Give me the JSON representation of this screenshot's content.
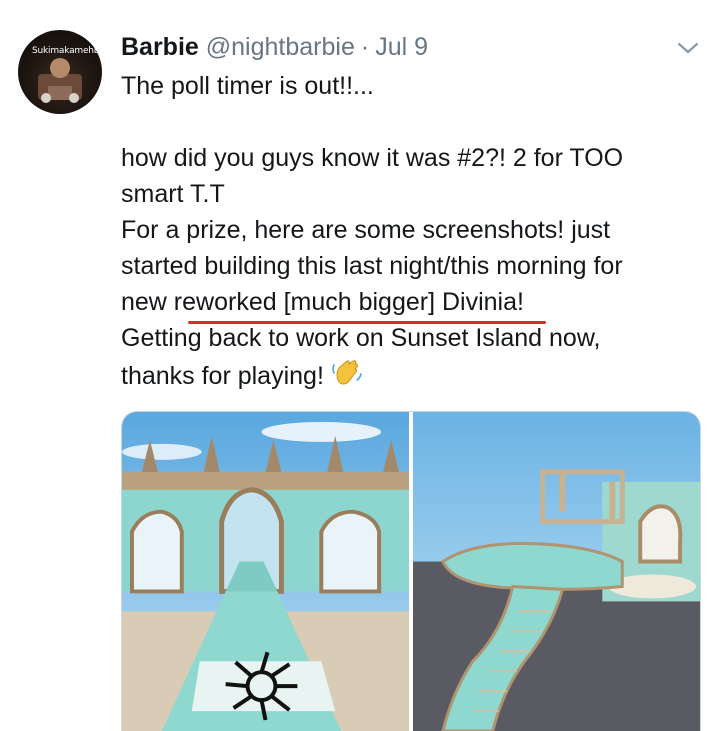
{
  "tweet": {
    "avatar_text": "Sukimakamehbob",
    "display_name": "Barbie",
    "handle": "@nightbarbie",
    "separator": "·",
    "date": "Jul 9",
    "text_lines": [
      "The poll timer is out!!...",
      "",
      "how did you guys know it was #2?! 2 for TOO",
      "smart T.T",
      "For a prize, here are some screenshots! just",
      "started building this last night/this morning for",
      "new reworked [much bigger] Divinia!",
      "Getting back to work on Sunset Island now,",
      "thanks for playing! "
    ],
    "emoji": "waving-hand",
    "media": [
      {
        "name": "screenshot-1",
        "content": "archway-corridor-with-star-tile"
      },
      {
        "name": "screenshot-2",
        "content": "spiral-staircase-platform"
      }
    ]
  },
  "colors": {
    "text": "#14171a",
    "secondary": "#657786",
    "underline": "#e0282e",
    "border": "#ccd6dd"
  }
}
